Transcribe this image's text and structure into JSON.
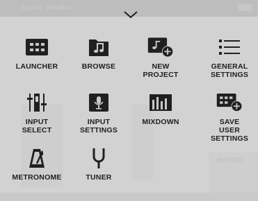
{
  "background": {
    "title": "Spark Studio",
    "secondary_text": "MASTER"
  },
  "menu": {
    "items": [
      {
        "label": "LAUNCHER",
        "icon": "launcher-grid-icon"
      },
      {
        "label": "BROWSE",
        "icon": "music-folder-icon"
      },
      {
        "label": "NEW\nPROJECT",
        "icon": "new-project-icon"
      },
      {
        "label": "GENERAL\nSETTINGS",
        "icon": "list-settings-icon"
      },
      {
        "label": "INPUT\nSELECT",
        "icon": "input-select-icon"
      },
      {
        "label": "INPUT\nSETTINGS",
        "icon": "microphone-icon"
      },
      {
        "label": "MIXDOWN",
        "icon": "mixdown-bars-icon"
      },
      {
        "label": "SAVE\nUSER SETTINGS",
        "icon": "save-settings-icon"
      },
      {
        "label": "METRONOME",
        "icon": "metronome-icon"
      },
      {
        "label": "TUNER",
        "icon": "tuning-fork-icon"
      }
    ]
  },
  "colors": {
    "icon": "#202020",
    "overlay": "#c9c9c9"
  }
}
